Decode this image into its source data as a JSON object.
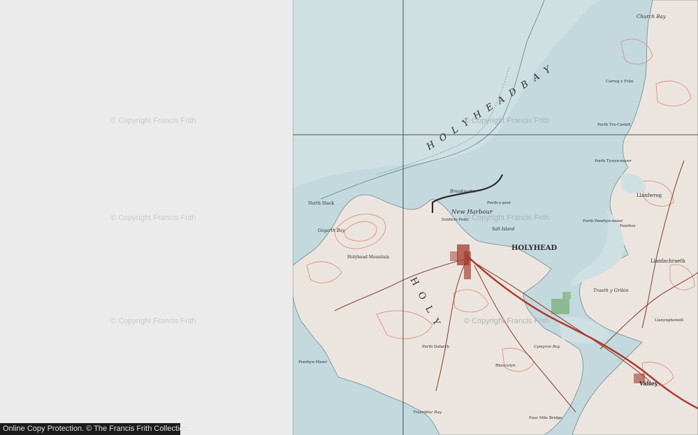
{
  "watermark": {
    "text": "© Copyright Francis Frith"
  },
  "footer": {
    "credit": "Online Copy Protection. © The Francis Frith Collection"
  },
  "map": {
    "labels": {
      "holyhead_bay": "H O L Y H E A D   B A Y",
      "holyhead_town": "HOLYHEAD",
      "holy_island": "H O L Y",
      "new_harbour": "New Harbour",
      "breakwater": "Breakwater",
      "salt_island": "Salt Island",
      "north_stack": "North Stack",
      "gogarth_bay": "Gogarth Bay",
      "holyhead_mountain": "Holyhead Mountain",
      "church_bay": "Church Bay",
      "porth_trecastell": "Porth Tre-Castell",
      "llanfwrog": "Llanfwrog",
      "llanfachraeth": "Llanfachraeth",
      "valley": "Valley",
      "traeth_y_gribin": "Traeth y Gribin",
      "penrhyn_mawr": "Penrhyn Mawr",
      "porth_dafarch": "Porth Dafarch",
      "trearddur_bay": "Trearddur Bay",
      "soldiers_point": "Soldiers Point",
      "porth_penrhyn_mawr": "Porth Penrhyn-mawr",
      "llanynghenedl": "Llanynghenedl",
      "porth_tywyn_mawr": "Porth Tywyn-mawr",
      "carreg_y_frân": "Carreg y Frân",
      "penrhos": "Penrhos",
      "cymyran_bay": "Cymyran Bay",
      "rhoscolyn": "Rhoscolyn",
      "four_mile_bridge": "Four Mile Bridge",
      "porth_y_post": "Porth-y-post"
    },
    "colors": {
      "sea": "#cfe0e3",
      "land": "#ece5df",
      "contour": "#d9917c",
      "water_shade": "#b9d3d8",
      "grid": "#2a2a2a",
      "rail": "#b03a2e",
      "road": "#8c4a3a",
      "town": "#a33b2e",
      "woodland": "#7fb07a"
    },
    "icon": "map-image"
  }
}
